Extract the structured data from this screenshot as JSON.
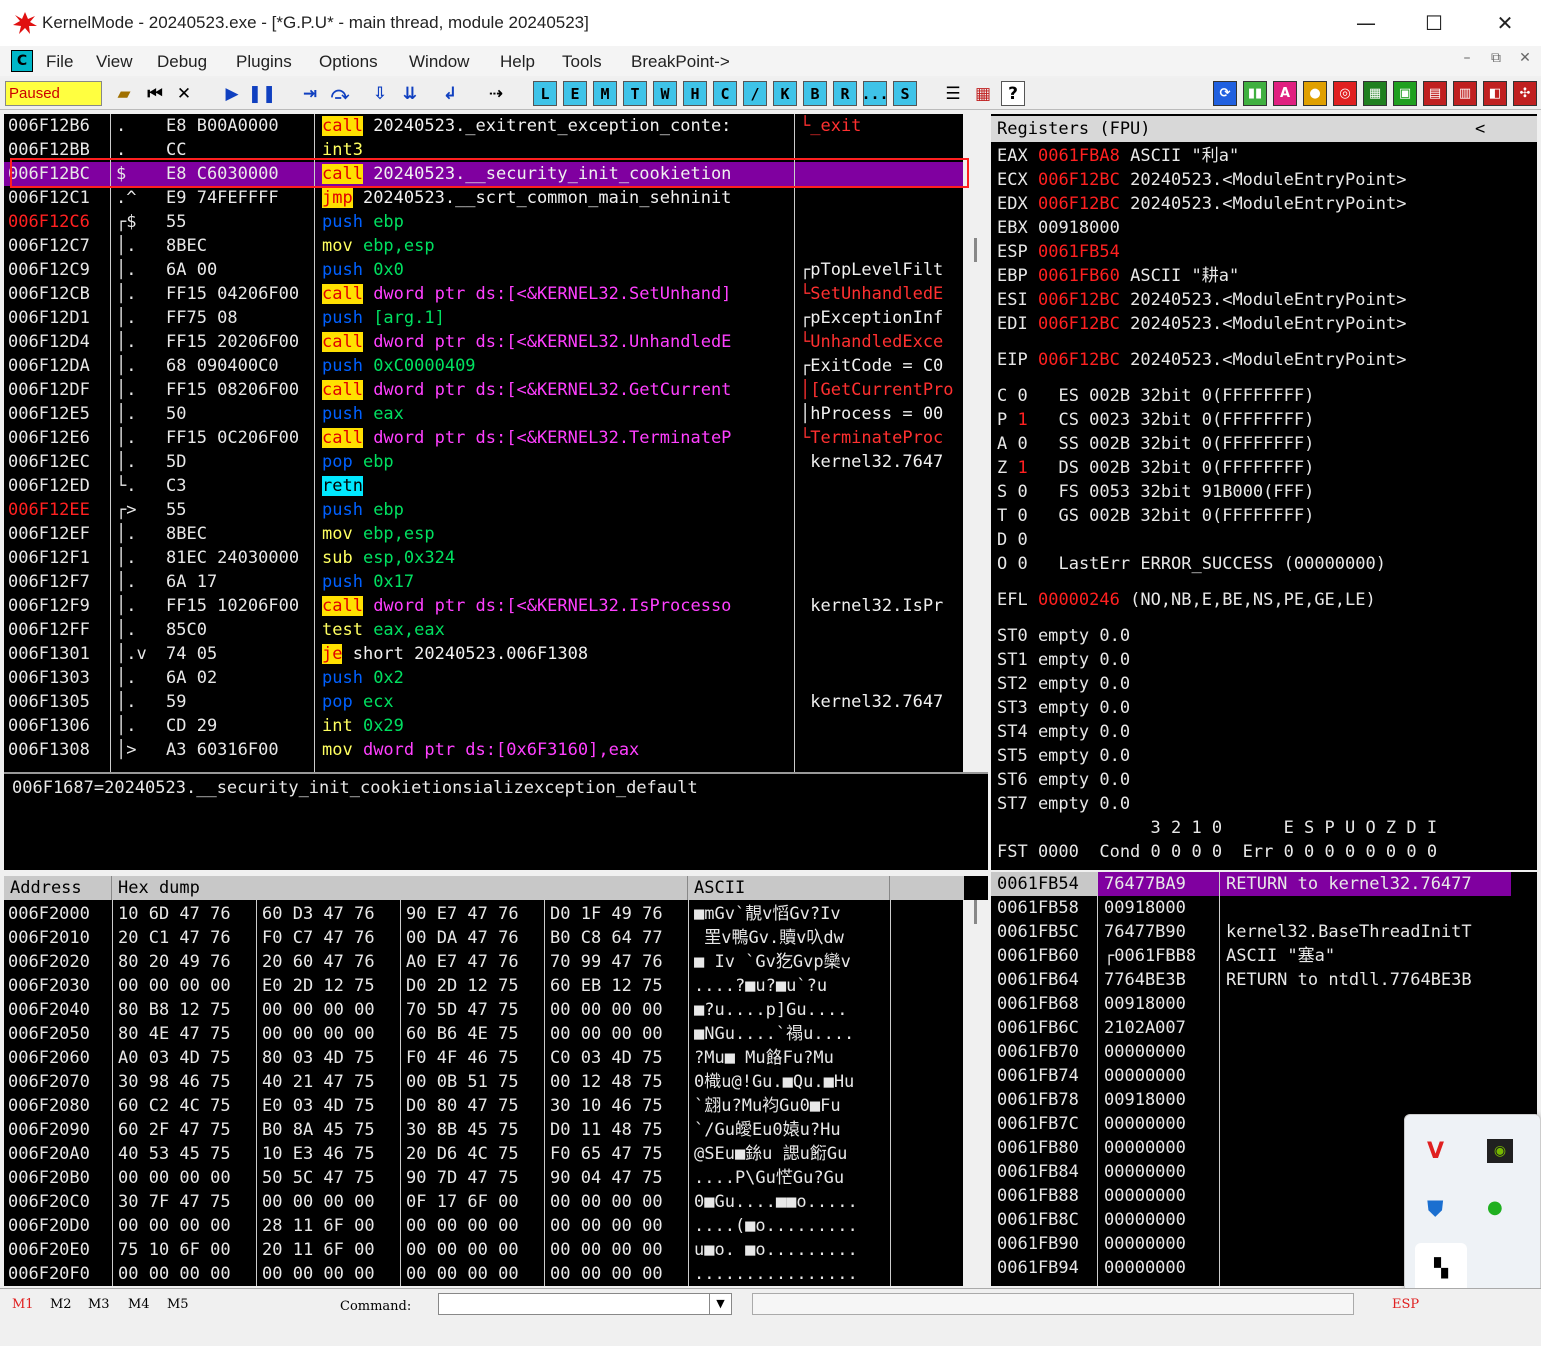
{
  "window": {
    "title": "KernelMode - 20240523.exe - [*G.P.U* - main thread, module 20240523]",
    "minimize": "—",
    "maximize": "☐",
    "close": "✕"
  },
  "menu": {
    "icon_label": "C",
    "items": [
      "File",
      "View",
      "Debug",
      "Plugins",
      "Options",
      "Window",
      "Help",
      "Tools",
      "BreakPoint->"
    ],
    "mdi": [
      "–",
      "⧉",
      "✕"
    ]
  },
  "toolbar": {
    "status": "Paused",
    "letter_buttons": [
      "L",
      "E",
      "M",
      "T",
      "W",
      "H",
      "C",
      "/",
      "K",
      "B",
      "R",
      "...",
      "S"
    ],
    "question": "?"
  },
  "disasm": {
    "rows": [
      {
        "addr": "006F12B6",
        "mark": ".",
        "hex": "E8 B00A0000",
        "mn": "call",
        "mnc": "kw-call",
        "op": " 20240523._exitrent_exception_conte:",
        "opc": "op-white",
        "cm": "└_exit",
        "cmc": "redtxt",
        "ac": ""
      },
      {
        "addr": "006F12BB",
        "mark": ".",
        "hex": "CC",
        "mn": "int3",
        "mnc": "kw-int3",
        "op": "",
        "opc": "op-white",
        "cm": "",
        "cmc": "",
        "ac": ""
      },
      {
        "addr": "006F12BC",
        "mark": "$",
        "hex": "E8 C6030000",
        "mn": "call",
        "mnc": "kw-call",
        "op": " 20240523.__security_init_cookietion",
        "opc": "op-white",
        "cm": "",
        "cmc": "",
        "ac": "",
        "sel": true
      },
      {
        "addr": "006F12C1",
        "mark": ".^",
        "hex": "E9 74FEFFFF",
        "mn": "jmp",
        "mnc": "kw-jmp",
        "op": " 20240523.__scrt_common_main_sehninit",
        "opc": "op-white",
        "cm": "",
        "cmc": "",
        "ac": ""
      },
      {
        "addr": "006F12C6",
        "mark": "┌$",
        "hex": "55",
        "mn": "push",
        "mnc": "kw-push",
        "op": " ebp",
        "opc": "op-green",
        "cm": "",
        "cmc": "",
        "ac": "addr-red"
      },
      {
        "addr": "006F12C7",
        "mark": "│.",
        "hex": "8BEC",
        "mn": "mov",
        "mnc": "kw-mov",
        "op": " ebp,esp",
        "opc": "op-green",
        "cm": "",
        "cmc": "",
        "ac": ""
      },
      {
        "addr": "006F12C9",
        "mark": "│.",
        "hex": "6A 00",
        "mn": "push",
        "mnc": "kw-push",
        "op": " 0x0",
        "opc": "op-green",
        "cm": "┌pTopLevelFilt",
        "cmc": "op-white",
        "ac": ""
      },
      {
        "addr": "006F12CB",
        "mark": "│.",
        "hex": "FF15 04206F00",
        "mn": "call",
        "mnc": "kw-call",
        "op": " dword ptr ds:[<&KERNEL32.SetUnhand]",
        "opc": "op-magenta",
        "cm": "└SetUnhandledE",
        "cmc": "redtxt",
        "ac": ""
      },
      {
        "addr": "006F12D1",
        "mark": "│.",
        "hex": "FF75 08",
        "mn": "push",
        "mnc": "kw-push",
        "op": " [arg.1]",
        "opc": "op-green",
        "cm": "┌pExceptionInf",
        "cmc": "op-white",
        "ac": ""
      },
      {
        "addr": "006F12D4",
        "mark": "│.",
        "hex": "FF15 20206F00",
        "mn": "call",
        "mnc": "kw-call",
        "op": " dword ptr ds:[<&KERNEL32.UnhandledE",
        "opc": "op-magenta",
        "cm": "└UnhandledExce",
        "cmc": "redtxt",
        "ac": ""
      },
      {
        "addr": "006F12DA",
        "mark": "│.",
        "hex": "68 090400C0",
        "mn": "push",
        "mnc": "kw-push",
        "op": " 0xC0000409",
        "opc": "op-green",
        "cm": "┌ExitCode = C0",
        "cmc": "op-white",
        "ac": ""
      },
      {
        "addr": "006F12DF",
        "mark": "│.",
        "hex": "FF15 08206F00",
        "mn": "call",
        "mnc": "kw-call",
        "op": " dword ptr ds:[<&KERNEL32.GetCurrent",
        "opc": "op-magenta",
        "cm": "│[GetCurrentPro",
        "cmc": "redtxt",
        "ac": ""
      },
      {
        "addr": "006F12E5",
        "mark": "│.",
        "hex": "50",
        "mn": "push",
        "mnc": "kw-push",
        "op": " eax",
        "opc": "op-green",
        "cm": "│hProcess = 00",
        "cmc": "op-white",
        "ac": ""
      },
      {
        "addr": "006F12E6",
        "mark": "│.",
        "hex": "FF15 0C206F00",
        "mn": "call",
        "mnc": "kw-call",
        "op": " dword ptr ds:[<&KERNEL32.TerminateP",
        "opc": "op-magenta",
        "cm": "└TerminateProc",
        "cmc": "redtxt",
        "ac": ""
      },
      {
        "addr": "006F12EC",
        "mark": "│.",
        "hex": "5D",
        "mn": "pop",
        "mnc": "kw-pop",
        "op": " ebp",
        "opc": "op-green",
        "cm": " kernel32.7647",
        "cmc": "op-white",
        "ac": ""
      },
      {
        "addr": "006F12ED",
        "mark": "└.",
        "hex": "C3",
        "mn": "retn",
        "mnc": "kw-retn",
        "op": "",
        "opc": "op-white",
        "cm": "",
        "cmc": "",
        "ac": ""
      },
      {
        "addr": "006F12EE",
        "mark": "┌>",
        "hex": "55",
        "mn": "push",
        "mnc": "kw-push",
        "op": " ebp",
        "opc": "op-green",
        "cm": "",
        "cmc": "",
        "ac": "addr-red"
      },
      {
        "addr": "006F12EF",
        "mark": "│.",
        "hex": "8BEC",
        "mn": "mov",
        "mnc": "kw-mov",
        "op": " ebp,esp",
        "opc": "op-green",
        "cm": "",
        "cmc": "",
        "ac": ""
      },
      {
        "addr": "006F12F1",
        "mark": "│.",
        "hex": "81EC 24030000",
        "mn": "sub",
        "mnc": "kw-sub",
        "op": " esp,0x324",
        "opc": "op-green",
        "cm": "",
        "cmc": "",
        "ac": ""
      },
      {
        "addr": "006F12F7",
        "mark": "│.",
        "hex": "6A 17",
        "mn": "push",
        "mnc": "kw-push",
        "op": " 0x17",
        "opc": "op-green",
        "cm": "",
        "cmc": "",
        "ac": ""
      },
      {
        "addr": "006F12F9",
        "mark": "│.",
        "hex": "FF15 10206F00",
        "mn": "call",
        "mnc": "kw-call",
        "op": " dword ptr ds:[<&KERNEL32.IsProcesso",
        "opc": "op-magenta",
        "cm": " kernel32.IsPr",
        "cmc": "op-white",
        "ac": ""
      },
      {
        "addr": "006F12FF",
        "mark": "│.",
        "hex": "85C0",
        "mn": "test",
        "mnc": "kw-test",
        "op": " eax,eax",
        "opc": "op-green",
        "cm": "",
        "cmc": "",
        "ac": ""
      },
      {
        "addr": "006F1301",
        "mark": "│.v",
        "hex": "74 05",
        "mn": "je",
        "mnc": "kw-je",
        "op": " short 20240523.006F1308",
        "opc": "op-white",
        "cm": "",
        "cmc": "",
        "ac": ""
      },
      {
        "addr": "006F1303",
        "mark": "│.",
        "hex": "6A 02",
        "mn": "push",
        "mnc": "kw-push",
        "op": " 0x2",
        "opc": "op-green",
        "cm": "",
        "cmc": "",
        "ac": ""
      },
      {
        "addr": "006F1305",
        "mark": "│.",
        "hex": "59",
        "mn": "pop",
        "mnc": "kw-pop",
        "op": " ecx",
        "opc": "op-green",
        "cm": " kernel32.7647",
        "cmc": "op-white",
        "ac": ""
      },
      {
        "addr": "006F1306",
        "mark": "│.",
        "hex": "CD 29",
        "mn": "int",
        "mnc": "kw-int",
        "op": " 0x29",
        "opc": "op-green",
        "cm": "",
        "cmc": "",
        "ac": ""
      },
      {
        "addr": "006F1308",
        "mark": "│>",
        "hex": "A3 60316F00",
        "mn": "mov",
        "mnc": "kw-mov",
        "op": " dword ptr ds:[0x6F3160],eax",
        "opc": "op-magenta",
        "cm": "",
        "cmc": "",
        "ac": ""
      }
    ],
    "info_line": "006F1687=20240523.__security_init_cookietionsializexception_default"
  },
  "registers": {
    "header": "Registers (FPU)",
    "collapse": "<",
    "gp": [
      {
        "name": "EAX",
        "val": "0061FBA8",
        "desc": " ASCII \"利a\""
      },
      {
        "name": "ECX",
        "val": "006F12BC",
        "desc": " 20240523.<ModuleEntryPoint>"
      },
      {
        "name": "EDX",
        "val": "006F12BC",
        "desc": " 20240523.<ModuleEntryPoint>"
      },
      {
        "name": "EBX",
        "val": "00918000",
        "desc": "",
        "white": true
      },
      {
        "name": "ESP",
        "val": "0061FB54",
        "desc": ""
      },
      {
        "name": "EBP",
        "val": "0061FB60",
        "desc": " ASCII \"耕a\""
      },
      {
        "name": "ESI",
        "val": "006F12BC",
        "desc": " 20240523.<ModuleEntryPoint>"
      },
      {
        "name": "EDI",
        "val": "006F12BC",
        "desc": " 20240523.<ModuleEntryPoint>"
      }
    ],
    "eip": {
      "name": "EIP",
      "val": "006F12BC",
      "desc": " 20240523.<ModuleEntryPoint>"
    },
    "flags": [
      {
        "f": "C",
        "v": "0",
        "seg": "ES 002B 32bit 0(FFFFFFFF)"
      },
      {
        "f": "P",
        "v": "1",
        "seg": "CS 0023 32bit 0(FFFFFFFF)",
        "red": true
      },
      {
        "f": "A",
        "v": "0",
        "seg": "SS 002B 32bit 0(FFFFFFFF)"
      },
      {
        "f": "Z",
        "v": "1",
        "seg": "DS 002B 32bit 0(FFFFFFFF)",
        "red": true
      },
      {
        "f": "S",
        "v": "0",
        "seg": "FS 0053 32bit 91B000(FFF)"
      },
      {
        "f": "T",
        "v": "0",
        "seg": "GS 002B 32bit 0(FFFFFFFF)"
      },
      {
        "f": "D",
        "v": "0",
        "seg": ""
      },
      {
        "f": "O",
        "v": "0",
        "seg": "LastErr ERROR_SUCCESS (00000000)"
      }
    ],
    "efl": {
      "name": "EFL",
      "val": "00000246",
      "desc": " (NO,NB,E,BE,NS,PE,GE,LE)"
    },
    "st": [
      "ST0 empty 0.0",
      "ST1 empty 0.0",
      "ST2 empty 0.0",
      "ST3 empty 0.0",
      "ST4 empty 0.0",
      "ST5 empty 0.0",
      "ST6 empty 0.0",
      "ST7 empty 0.0"
    ],
    "fpu_bits_header": "               3 2 1 0      E S P U O Z D I",
    "fst": "FST 0000  Cond 0 0 0 0  Err 0 0 0 0 0 0 0 0"
  },
  "dump": {
    "headers": [
      "Address",
      "Hex dump",
      "ASCII"
    ],
    "rows": [
      {
        "a": "006F2000",
        "h": [
          "10 6D 47 76",
          "60 D3 47 76",
          "90 E7 47 76",
          "D0 1F 49 76"
        ],
        "s": "■mGv`靚v慆Gv?Iv"
      },
      {
        "a": "006F2010",
        "h": [
          "20 C1 47 76",
          "F0 C7 47 76",
          "00 DA 47 76",
          "B0 C8 64 77"
        ],
        "s": " 罜v鴨Gv.贖v叺dw"
      },
      {
        "a": "006F2020",
        "h": [
          "80 20 49 76",
          "20 60 47 76",
          "A0 E7 47 76",
          "70 99 47 76"
        ],
        "s": "■ Iv `Gv犵Gvp欒v"
      },
      {
        "a": "006F2030",
        "h": [
          "00 00 00 00",
          "E0 2D 12 75",
          "D0 2D 12 75",
          "60 EB 12 75"
        ],
        "s": "....?■u?■u`?u"
      },
      {
        "a": "006F2040",
        "h": [
          "80 B8 12 75",
          "00 00 00 00",
          "70 5D 47 75",
          "00 00 00 00"
        ],
        "s": "■?u....p]Gu...."
      },
      {
        "a": "006F2050",
        "h": [
          "80 4E 47 75",
          "00 00 00 00",
          "60 B6 4E 75",
          "00 00 00 00"
        ],
        "s": "■NGu....`禢u...."
      },
      {
        "a": "006F2060",
        "h": [
          "A0 03 4D 75",
          "80 03 4D 75",
          "F0 4F 46 75",
          "C0 03 4D 75"
        ],
        "s": "?Mu■ Mu餎Fu?Mu"
      },
      {
        "a": "006F2070",
        "h": [
          "30 98 46 75",
          "40 21 47 75",
          "00 0B 51 75",
          "00 12 48 75"
        ],
        "s": "0樴u@!Gu.■Qu.■Hu"
      },
      {
        "a": "006F2080",
        "h": [
          "60 C2 4C 75",
          "E0 03 4D 75",
          "D0 80 47 75",
          "30 10 46 75"
        ],
        "s": "`翝u?Mu袀Gu0■Fu"
      },
      {
        "a": "006F2090",
        "h": [
          "60 2F 47 75",
          "B0 8A 45 75",
          "30 8B 45 75",
          "D0 11 48 75"
        ],
        "s": "`/Gu皧Eu0媴u?Hu"
      },
      {
        "a": "006F20A0",
        "h": [
          "40 53 45 75",
          "10 E3 46 75",
          "20 D6 4C 75",
          "F0 65 47 75"
        ],
        "s": "@SEu■銯u 諰u餰Gu"
      },
      {
        "a": "006F20B0",
        "h": [
          "00 00 00 00",
          "50 5C 47 75",
          "90 7D 47 75",
          "90 04 47 75"
        ],
        "s": "....P\\Gu恾Gu?Gu"
      },
      {
        "a": "006F20C0",
        "h": [
          "30 7F 47 75",
          "00 00 00 00",
          "0F 17 6F 00",
          "00 00 00 00"
        ],
        "s": "0■Gu....■■o....."
      },
      {
        "a": "006F20D0",
        "h": [
          "00 00 00 00",
          "28 11 6F 00",
          "00 00 00 00",
          "00 00 00 00"
        ],
        "s": "....(■o........."
      },
      {
        "a": "006F20E0",
        "h": [
          "75 10 6F 00",
          "20 11 6F 00",
          "00 00 00 00",
          "00 00 00 00"
        ],
        "s": "u■o. ■o........."
      },
      {
        "a": "006F20F0",
        "h": [
          "00 00 00 00",
          "00 00 00 00",
          "00 00 00 00",
          "00 00 00 00"
        ],
        "s": "................"
      }
    ]
  },
  "stack": {
    "rows": [
      {
        "a": "0061FB54",
        "v": "76477BA9",
        "c": "RETURN to kernel32.76477",
        "sel": true
      },
      {
        "a": "0061FB58",
        "v": "00918000",
        "c": ""
      },
      {
        "a": "0061FB5C",
        "v": "76477B90",
        "c": "kernel32.BaseThreadInitT"
      },
      {
        "a": "0061FB60",
        "v": "┌0061FBB8",
        "c": "ASCII \"塞a\""
      },
      {
        "a": "0061FB64",
        "v": "7764BE3B",
        "c": "RETURN to ntdll.7764BE3B"
      },
      {
        "a": "0061FB68",
        "v": "00918000",
        "c": ""
      },
      {
        "a": "0061FB6C",
        "v": "2102A007",
        "c": ""
      },
      {
        "a": "0061FB70",
        "v": "00000000",
        "c": ""
      },
      {
        "a": "0061FB74",
        "v": "00000000",
        "c": ""
      },
      {
        "a": "0061FB78",
        "v": "00918000",
        "c": ""
      },
      {
        "a": "0061FB7C",
        "v": "00000000",
        "c": ""
      },
      {
        "a": "0061FB80",
        "v": "00000000",
        "c": ""
      },
      {
        "a": "0061FB84",
        "v": "00000000",
        "c": ""
      },
      {
        "a": "0061FB88",
        "v": "00000000",
        "c": ""
      },
      {
        "a": "0061FB8C",
        "v": "00000000",
        "c": ""
      },
      {
        "a": "0061FB90",
        "v": "00000000",
        "c": ""
      },
      {
        "a": "0061FB94",
        "v": "00000000",
        "c": ""
      }
    ]
  },
  "bottom": {
    "mtabs": [
      "M1",
      "M2",
      "M3",
      "M4",
      "M5"
    ],
    "command_label": "Command:",
    "command_value": "",
    "esp_label": "ESP"
  },
  "colors": {
    "selection": "#8000a0",
    "highlight_border": "#ff2020",
    "register_changed": "#ff2020"
  }
}
